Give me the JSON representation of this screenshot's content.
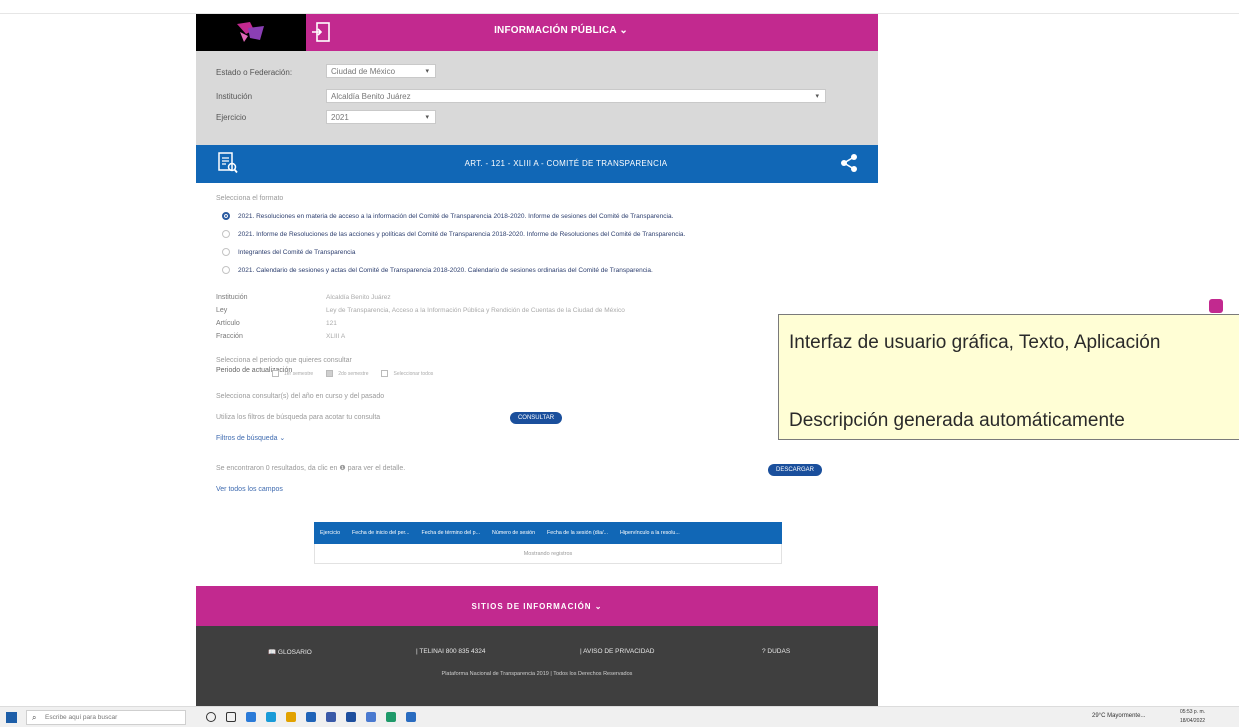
{
  "header": {
    "title": "INFORMACIÓN PÚBLICA ⌄"
  },
  "filters": {
    "estado_label": "Estado o Federación:",
    "estado_value": "Ciudad de México",
    "institucion_label": "Institución",
    "institucion_value": "Alcaldía Benito Juárez",
    "ejercicio_label": "Ejercicio",
    "ejercicio_value": "2021"
  },
  "banner": {
    "title": "ART. - 121 - XLIII A - COMITÉ DE TRANSPARENCIA"
  },
  "format_label": "Selecciona el formato",
  "formats": [
    "2021. Resoluciones en materia de acceso a la información del Comité de Transparencia 2018-2020. Informe de sesiones del Comité de Transparencia.",
    "2021. Informe de Resoluciones de las acciones y políticas del Comité de Transparencia 2018-2020. Informe de Resoluciones del Comité de Transparencia.",
    "Integrantes del Comité de Transparencia",
    "2021. Calendario de sesiones y actas del Comité de Transparencia 2018-2020. Calendario de sesiones ordinarias del Comité de Transparencia."
  ],
  "info": {
    "institucion_k": "Institución",
    "institucion_v": "Alcaldía Benito Juárez",
    "ley_k": "Ley",
    "ley_v": "Ley de Transparencia, Acceso a la Información Pública y Rendición de Cuentas de la Ciudad de México",
    "articulo_k": "Artículo",
    "articulo_v": "121",
    "fraccion_k": "Fracción",
    "fraccion_v": "XLIII A"
  },
  "period": {
    "prompt": "Selecciona el periodo que quieres consultar",
    "label": "Periodo de actualización",
    "opt1": "1er semestre",
    "opt2": "2do semestre",
    "opt3": "Seleccionar todos"
  },
  "consult": {
    "hint": "Selecciona consultar(s) del año en curso y del pasado",
    "filters_hint": "Utiliza los filtros de búsqueda para acotar tu consulta",
    "button": "CONSULTAR",
    "search_filters": "Filtros de búsqueda ⌄"
  },
  "results": {
    "found": "Se encontraron 0 resultados, da clic en ❶ para ver el detalle.",
    "download": "DESCARGAR",
    "see_all": "Ver todos los campos"
  },
  "table": {
    "headers": [
      "Ejercicio",
      "Fecha de inicio del per...",
      "Fecha de término del p...",
      "Número de sesión",
      "Fecha de la sesión (día/...",
      "Hipervínculo a la resolu..."
    ],
    "empty": "Mostrando registros"
  },
  "footer": {
    "title": "SITIOS DE INFORMACIÓN ⌄",
    "glosario": "GLOSARIO",
    "telinai": "TELINAI 800 835 4324",
    "aviso": "AVISO DE PRIVACIDAD",
    "dudas": "DUDAS",
    "copyright": "Plataforma Nacional de Transparencia 2019 | Todos los Derechos Reservados"
  },
  "tooltip": {
    "line1": "Interfaz de usuario gráfica, Texto, Aplicación",
    "line2": "Descripción generada automáticamente"
  },
  "taskbar": {
    "search_placeholder": "Escribe aquí para buscar",
    "weather": "29°C Mayormente...",
    "time": "05:53 p. m.",
    "date": "18/04/2022"
  },
  "colors": {
    "pink": "#c2298f",
    "blue": "#1167b6",
    "dark": "#3f3f3f"
  }
}
